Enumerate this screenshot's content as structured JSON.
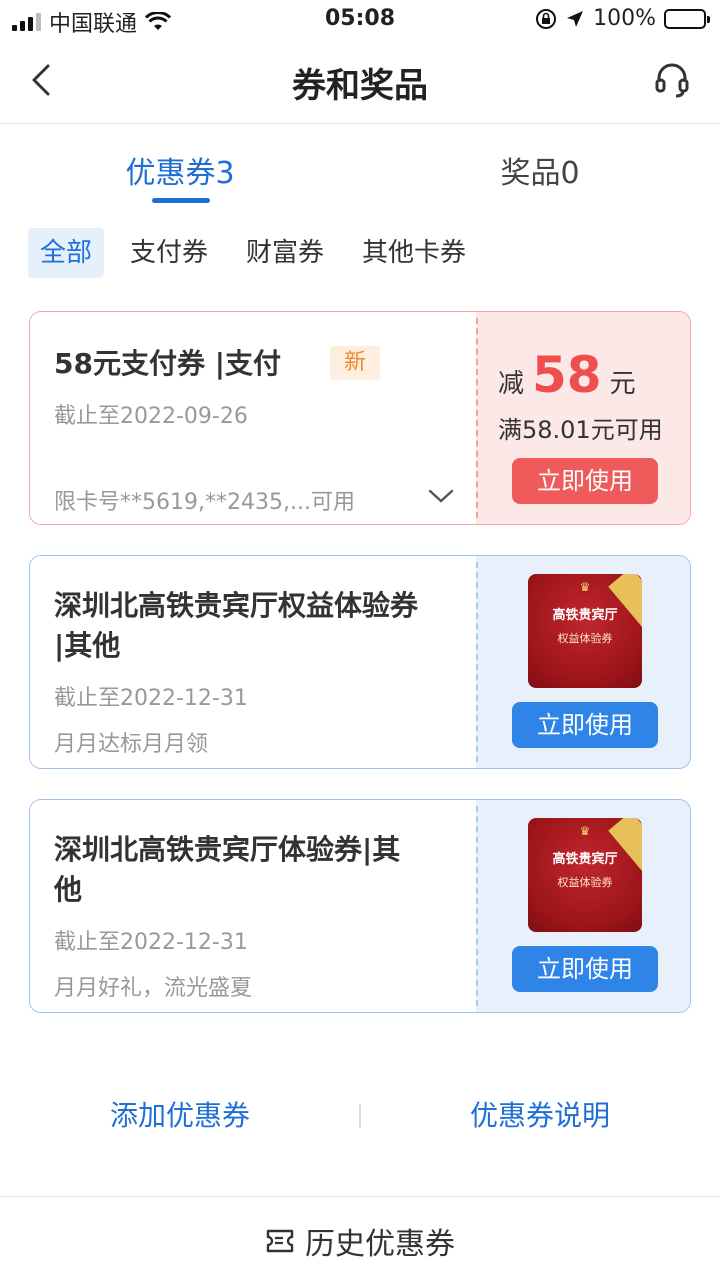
{
  "status_bar": {
    "carrier": "中国联通",
    "time": "05:08",
    "battery": "100%"
  },
  "header": {
    "title": "券和奖品"
  },
  "tabs": [
    {
      "label": "优惠券3"
    },
    {
      "label": "奖品0"
    }
  ],
  "filters": [
    {
      "label": "全部"
    },
    {
      "label": "支付券"
    },
    {
      "label": "财富券"
    },
    {
      "label": "其他卡券"
    }
  ],
  "coupons": [
    {
      "title": "58元支付券 |支付",
      "badge": "新",
      "expiry": "截止至2022-09-26",
      "note": "限卡号**5619,**2435,...可用",
      "prefix": "减",
      "amount": "58",
      "unit": "元",
      "threshold": "满58.01元可用",
      "action": "立即使用",
      "accent": "#ef5a5a"
    },
    {
      "title_line1": "深圳北高铁贵宾厅权益体验券",
      "title_line2": "|其他",
      "expiry": "截止至2022-12-31",
      "note": "月月达标月月领",
      "image_text": [
        "高铁贵宾厅",
        "权益体验券"
      ],
      "action": "立即使用",
      "accent": "#2f84e7"
    },
    {
      "title_line1": "深圳北高铁贵宾厅体验券|其",
      "title_line2": "他",
      "expiry": "截止至2022-12-31",
      "note": "月月好礼，流光盛夏",
      "image_text": [
        "高铁贵宾厅",
        "权益体验券"
      ],
      "action": "立即使用",
      "accent": "#2f84e7"
    }
  ],
  "footer": {
    "add_link": "添加优惠券",
    "help_link": "优惠券说明",
    "history": "历史优惠券"
  },
  "colors": {
    "primary": "#1f6fd6",
    "danger": "#ef4e4e"
  },
  "icons": [
    "signal-icon",
    "wifi-icon",
    "lock-rotation-icon",
    "location-arrow-icon",
    "battery-icon",
    "back-arrow-icon",
    "headset-icon",
    "chevron-down-icon",
    "ticket-icon"
  ]
}
